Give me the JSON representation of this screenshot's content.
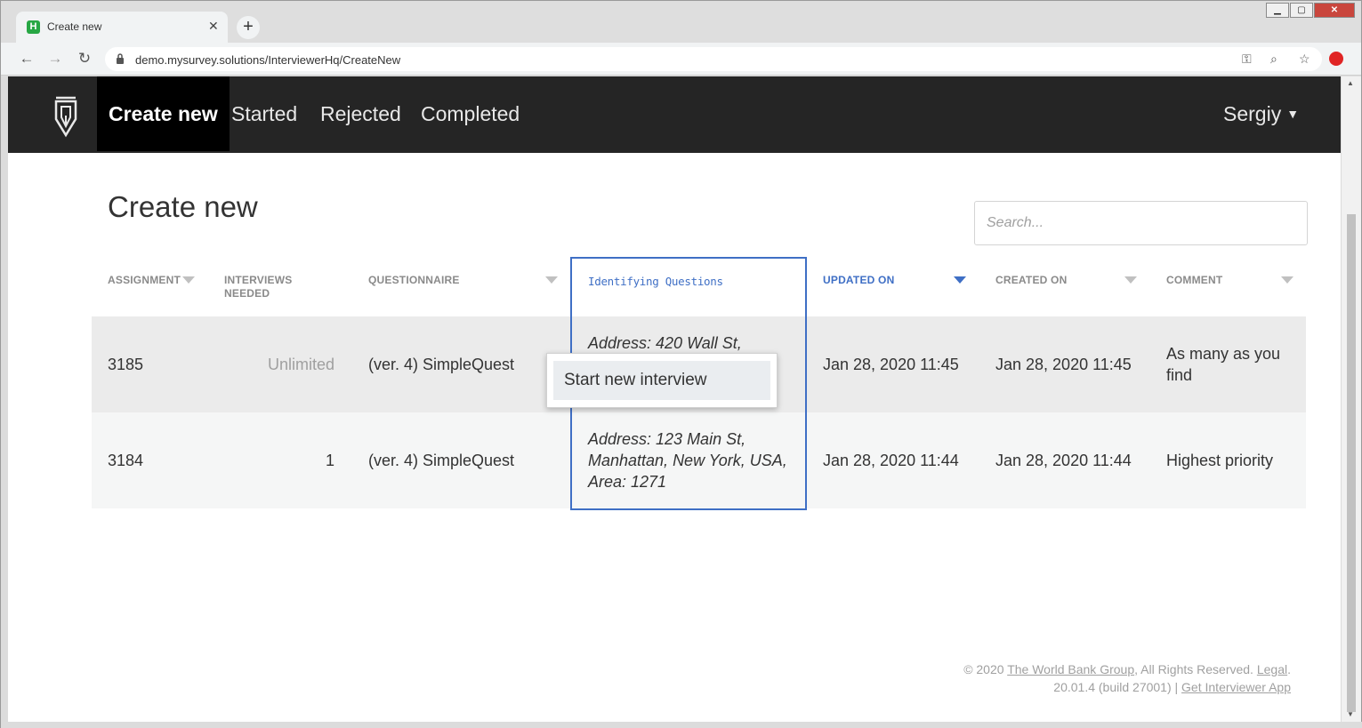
{
  "browser": {
    "tab_title": "Create new",
    "favicon_letter": "H",
    "url": "demo.mysurvey.solutions/InterviewerHq/CreateNew"
  },
  "nav": {
    "items": [
      {
        "label": "Create new",
        "active": true
      },
      {
        "label": "Started"
      },
      {
        "label": "Rejected"
      },
      {
        "label": "Completed"
      }
    ],
    "user": "Sergiy"
  },
  "page": {
    "title": "Create new",
    "search_placeholder": "Search..."
  },
  "table": {
    "columns": {
      "assignment": "ASSIGNMENT",
      "interviews_needed_1": "INTERVIEWS",
      "interviews_needed_2": "NEEDED",
      "questionnaire": "QUESTIONNAIRE",
      "identifying": "Identifying Questions",
      "updated_on": "UPDATED ON",
      "created_on": "CREATED ON",
      "comment": "COMMENT"
    },
    "rows": [
      {
        "assignment": "3185",
        "interviews_needed": "Unlimited",
        "questionnaire": "(ver. 4) SimpleQuest",
        "identifying": "Address: 420 Wall St,",
        "updated_on": "Jan 28, 2020 11:45",
        "created_on": "Jan 28, 2020 11:45",
        "comment_1": "As many as you",
        "comment_2": "find"
      },
      {
        "assignment": "3184",
        "interviews_needed": "1",
        "questionnaire": "(ver. 4) SimpleQuest",
        "identifying_1": "Address: 123 Main St,",
        "identifying_2": "Manhattan, New York, USA,",
        "identifying_3": "Area: 1271",
        "updated_on": "Jan 28, 2020 11:44",
        "created_on": "Jan 28, 2020 11:44",
        "comment": "Highest priority"
      }
    ]
  },
  "popup": {
    "item": "Start new interview"
  },
  "footer": {
    "copyright_prefix": "© 2020 ",
    "org_link": "The World Bank Group",
    "rights": ", All Rights Reserved. ",
    "legal_link": "Legal",
    "legal_suffix": ".",
    "version": "20.01.4 (build 27001) | ",
    "app_link": "Get Interviewer App"
  },
  "colors": {
    "nav_bg": "#252525",
    "accent": "#3f6fc5",
    "row_alt": "#ebebeb"
  }
}
